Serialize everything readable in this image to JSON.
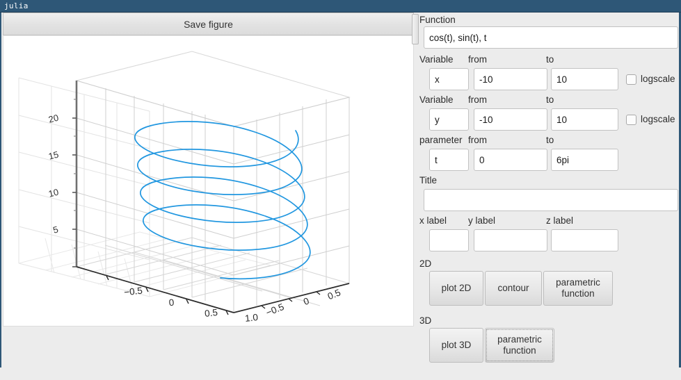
{
  "window": {
    "title": "julia"
  },
  "toolbar": {
    "save_figure_label": "Save figure"
  },
  "form": {
    "function_label": "Function",
    "function_value": "cos(t), sin(t), t",
    "var_x": {
      "variable_label": "Variable",
      "from_label": "from",
      "to_label": "to",
      "variable_value": "x",
      "from_value": "-10",
      "to_value": "10",
      "logscale_label": "logscale",
      "logscale_checked": false
    },
    "var_y": {
      "variable_label": "Variable",
      "from_label": "from",
      "to_label": "to",
      "variable_value": "y",
      "from_value": "-10",
      "to_value": "10",
      "logscale_label": "logscale",
      "logscale_checked": false
    },
    "param": {
      "parameter_label": "parameter",
      "from_label": "from",
      "to_label": "to",
      "parameter_value": "t",
      "from_value": "0",
      "to_value": "6pi"
    },
    "title_label": "Title",
    "title_value": "",
    "xlabel_label": "x label",
    "ylabel_label": "y label",
    "zlabel_label": "z label",
    "xlabel_value": "",
    "ylabel_value": "",
    "zlabel_value": ""
  },
  "sections": {
    "twod_label": "2D",
    "threed_label": "3D"
  },
  "buttons": {
    "plot_2d": "plot 2D",
    "contour": "contour",
    "parametric_function_2d": "parametric\nfunction",
    "plot_3d": "plot 3D",
    "parametric_function_3d": "parametric\nfunction"
  },
  "chart_data": {
    "type": "line",
    "title": "",
    "projection": "3d",
    "function": "cos(t), sin(t), t",
    "parameter": {
      "name": "t",
      "from": 0,
      "to": "6pi"
    },
    "xlabel": "",
    "ylabel": "",
    "zlabel": "",
    "xlim": [
      -1.0,
      1.0
    ],
    "ylim": [
      -1.0,
      1.0
    ],
    "zlim": [
      0,
      20
    ],
    "x_ticks": [
      "-0.5",
      "0",
      "0.5",
      "1.0"
    ],
    "y_ticks": [
      "-0.5",
      "0",
      "0.5"
    ],
    "z_ticks": [
      "5",
      "10",
      "15",
      "20"
    ],
    "grid": true,
    "legend": false,
    "series": [
      {
        "name": "helix",
        "color": "#2197e0",
        "linewidth": 1.6,
        "turns": 3,
        "description": "parametric helix x=cos(t), y=sin(t), z=t for t in [0, 6pi]"
      }
    ]
  }
}
